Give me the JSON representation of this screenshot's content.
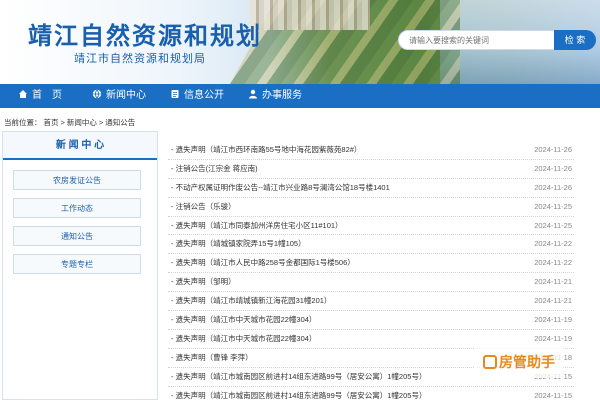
{
  "header": {
    "title": "靖江自然资源和规划",
    "subtitle": "靖江市自然资源和规划局",
    "search_placeholder": "请输入要搜索的关键词",
    "search_button": "检 索"
  },
  "nav": [
    {
      "label": "首　页",
      "icon": "home-icon"
    },
    {
      "label": "新闻中心",
      "icon": "globe-icon"
    },
    {
      "label": "信息公开",
      "icon": "document-icon"
    },
    {
      "label": "办事服务",
      "icon": "person-icon"
    }
  ],
  "breadcrumb": {
    "label": "当前位置：",
    "items": [
      "首页",
      "新闻中心",
      "通知公告"
    ],
    "sep": ">"
  },
  "sidebar": {
    "heading": "新 闻 中 心",
    "items": [
      "农房发证公告",
      "工作动态",
      "通知公告",
      "专题专栏"
    ]
  },
  "list": [
    {
      "title": "- 遗失声明（靖江市西环南路55号地中海花园紫薇苑82#）",
      "date": "2024-11-26"
    },
    {
      "title": "- 注销公告(江宗金  蒋应南)",
      "date": "2024-11-26"
    },
    {
      "title": "- 不动产权属证明作废公告--靖江市兴业路8号澜湾公馆18号楼1401",
      "date": "2024-11-26"
    },
    {
      "title": "- 注销公告（乐骏）",
      "date": "2024-11-25"
    },
    {
      "title": "- 遗失声明（靖江市同泰加州洋房住宅小区11#101）",
      "date": "2024-11-25"
    },
    {
      "title": "- 遗失声明（靖城镇家院弄15号1幢105）",
      "date": "2024-11-22"
    },
    {
      "title": "- 遗失声明（靖江市人民中路258号金都国际1号楼506）",
      "date": "2024-11-22"
    },
    {
      "title": "- 遗失声明（邹明）",
      "date": "2024-11-21"
    },
    {
      "title": "- 遗失声明（靖江市靖城镇新江海花园31幢201）",
      "date": "2024-11-21"
    },
    {
      "title": "- 遗失声明（靖江市中天城市花园22幢304）",
      "date": "2024-11-19"
    },
    {
      "title": "- 遗失声明（靖江市中天城市花园22幢304）",
      "date": "2024-11-19"
    },
    {
      "title": "- 遗失声明（曹锋  李萍）",
      "date": "2024-11-18"
    },
    {
      "title": "- 遗失声明（靖江市城南园区前进村14组东进路99号（居安公寓）1幢205号）",
      "date": "2024-11-15"
    },
    {
      "title": "- 遗失声明（靖江市城南园区前进村14组东进路99号（居安公寓）1幢205号）",
      "date": "2024-11-15"
    }
  ],
  "watermark": "房管助手",
  "colors": {
    "primary": "#1a6fc4",
    "title": "#1a5fae",
    "date": "#888888",
    "watermark": "#e8891a"
  }
}
